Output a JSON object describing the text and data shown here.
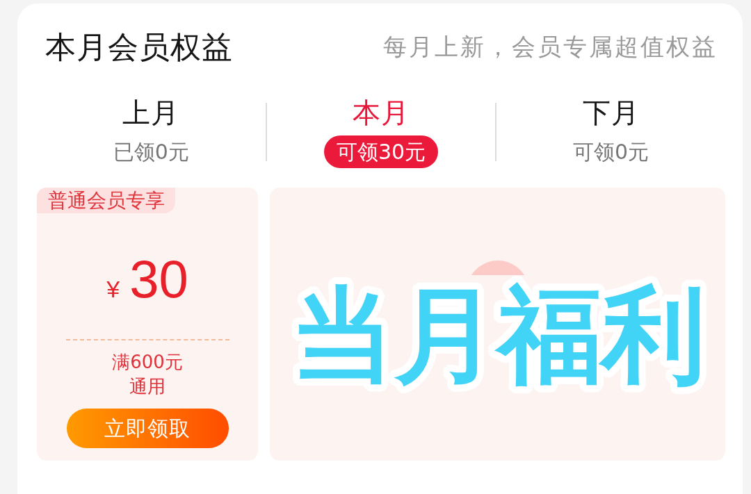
{
  "header": {
    "title": "本月会员权益",
    "subtitle": "每月上新，会员专属超值权益"
  },
  "tabs": [
    {
      "label": "上月",
      "amount": "已领0元",
      "selected": false
    },
    {
      "label": "本月",
      "amount": "可领30元",
      "selected": true
    },
    {
      "label": "下月",
      "amount": "可领0元",
      "selected": false
    }
  ],
  "coupon": {
    "badge": "普通会员专享",
    "currency": "¥",
    "amount": "30",
    "condition": "满600元通用",
    "button": "立即领取"
  },
  "benefit_panel": {
    "overlay_text": "当月福利"
  }
}
